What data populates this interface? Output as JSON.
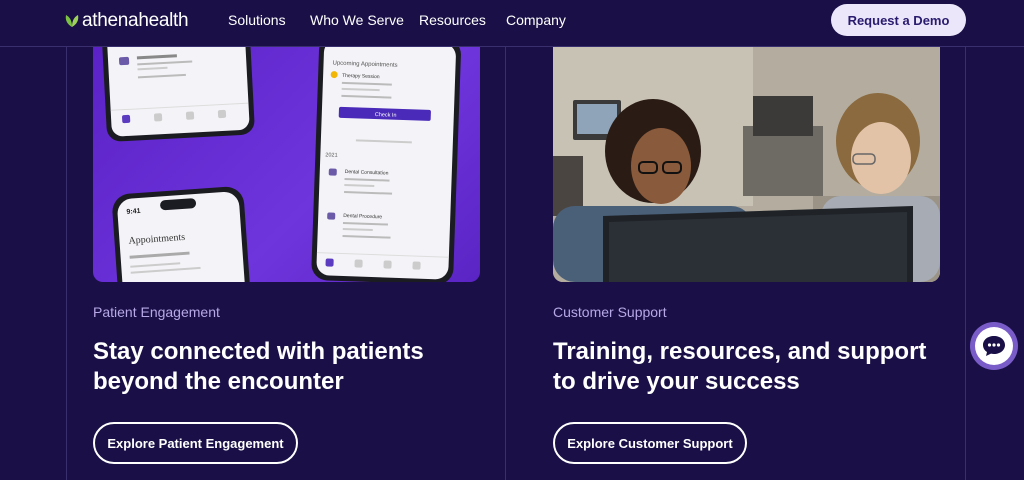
{
  "nav": {
    "logo_text": "athenahealth",
    "links": [
      "Solutions",
      "Who We Serve",
      "Resources",
      "Company"
    ],
    "cta": "Request a Demo"
  },
  "cards": [
    {
      "eyebrow": "Patient Engagement",
      "heading": "Stay connected with patients beyond the encounter",
      "button": "Explore Patient Engagement",
      "phone_texts": {
        "dental_procedure": "Dental Procedure",
        "upcoming": "Upcoming Appointments",
        "therapy": "Therapy Session",
        "check_in": "Check In",
        "year": "2021",
        "dental_consult": "Dental Consultation",
        "time": "9:41",
        "appointments": "Appointments"
      }
    },
    {
      "eyebrow": "Customer Support",
      "heading": "Training, resources, and support to drive your success",
      "button": "Explore Customer Support"
    }
  ],
  "colors": {
    "background": "#1a1047",
    "accent_purple": "#6b2fd6",
    "eyebrow": "#b7a8e6",
    "cta_bg": "#ece6fb",
    "logo_leaf": "#7cc242"
  },
  "icons": {
    "chat": "chat-bubble-icon",
    "logo": "leaf-icon"
  }
}
